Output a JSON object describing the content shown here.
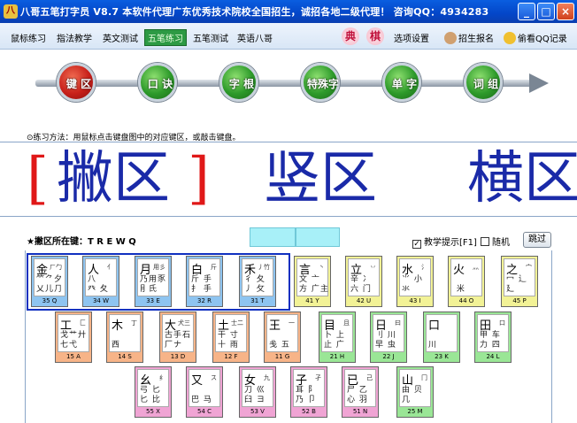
{
  "window": {
    "title": "八哥五笔打字员 V8.7   本软件代理广东优秀技术院校全国招生，诚招各地二级代理！ 咨询QQ：4934283",
    "buttons": [
      "_",
      "□",
      "×"
    ]
  },
  "menu": {
    "items": [
      "鼠标练习",
      "指法教学",
      "英文测试",
      "五笔练习",
      "五笔测试",
      "英语八哥"
    ],
    "active_index": 3,
    "seals": [
      "典",
      "棋"
    ],
    "right_items": [
      "选项设置",
      "招生报名",
      "偷看QQ记录"
    ]
  },
  "steps": {
    "labels": [
      "键 区",
      "口 诀",
      "字 根",
      "特殊字",
      "单 字",
      "词 组"
    ],
    "active_index": 0
  },
  "instructions": "⊙练习方法：用鼠标点击键盘图中的对应键区，或敲击键盘。",
  "display": {
    "bracket_left": "[",
    "current": "撇区",
    "bracket_right": "]",
    "next": "竖区",
    "after": "横区"
  },
  "hint": {
    "label": "★撇区所在键：",
    "keys": "T R E W Q"
  },
  "options": {
    "teach_hint": "教学提示[F1]",
    "teach_hint_checked": true,
    "random": "随机",
    "random_checked": false,
    "skip": "跳过"
  },
  "keyboard": {
    "rows": [
      [
        {
          "root": "金",
          "code": "ㄏ勹",
          "subs": "⺮⺈夕\n乂儿⺆",
          "label": "35 Q",
          "color": "blue"
        },
        {
          "root": "人",
          "code": "亻",
          "subs": "八\n癶 夂",
          "label": "34 W",
          "color": "blue"
        },
        {
          "root": "月",
          "code": "用彡",
          "subs": "乃用豕\n⺝氏",
          "label": "33 E",
          "color": "blue"
        },
        {
          "root": "白",
          "code": "斤",
          "subs": "斤 手\n⺘ 手",
          "label": "32 R",
          "color": "blue"
        },
        {
          "root": "禾",
          "code": "丿竹",
          "subs": "彳 夂\n丿 攵",
          "label": "31 T",
          "color": "blue"
        },
        {
          "root": "言",
          "code": "丶",
          "subs": "文 亠\n方 广主",
          "label": "41 Y",
          "color": "yellow"
        },
        {
          "root": "立",
          "code": "丷",
          "subs": "辛 冫\n六 门",
          "label": "42 U",
          "color": "yellow"
        },
        {
          "root": "水",
          "code": "氵",
          "subs": "⺌ 小\n氺",
          "label": "43 I",
          "color": "yellow"
        },
        {
          "root": "火",
          "code": "灬",
          "subs": "\n 米",
          "label": "44 O",
          "color": "yellow"
        },
        {
          "root": "之",
          "code": "宀",
          "subs": "冖 辶\n廴",
          "label": "45 P",
          "color": "yellow"
        }
      ],
      [
        {
          "root": "工",
          "code": "匚",
          "subs": "戈艹廾\n七弋",
          "label": "15 A",
          "color": "orange"
        },
        {
          "root": "木",
          "code": "丁",
          "subs": "\n西",
          "label": "14 S",
          "color": "orange"
        },
        {
          "root": "大",
          "code": "犬三",
          "subs": "古手石\n厂ナ",
          "label": "13 D",
          "color": "orange"
        },
        {
          "root": "土",
          "code": "士二",
          "subs": "干 寸\n十 雨",
          "label": "12 F",
          "color": "orange"
        },
        {
          "root": "王",
          "code": "一",
          "subs": "\n戋 五",
          "label": "11 G",
          "color": "orange"
        },
        {
          "root": "目",
          "code": "且",
          "subs": "卜 上\n止 广",
          "label": "21 H",
          "color": "green"
        },
        {
          "root": "日",
          "code": "曰",
          "subs": "刂 川\n早 虫",
          "label": "22 J",
          "color": "green"
        },
        {
          "root": "口",
          "code": "",
          "subs": "\n川",
          "label": "23 K",
          "color": "green"
        },
        {
          "root": "田",
          "code": "口",
          "subs": "甲 车\n力 四",
          "label": "24 L",
          "color": "green"
        }
      ],
      [
        {
          "root": "幺",
          "code": "纟",
          "subs": "弓 匕\n匕 比",
          "label": "55 X",
          "color": "pink"
        },
        {
          "root": "又",
          "code": "ス",
          "subs": "\n巴 马",
          "label": "54 C",
          "color": "pink"
        },
        {
          "root": "女",
          "code": "九",
          "subs": "刀 巛\n臼 ヨ",
          "label": "53 V",
          "color": "pink"
        },
        {
          "root": "子",
          "code": "孑",
          "subs": "耳 阝\n乃 卩",
          "label": "52 B",
          "color": "pink"
        },
        {
          "root": "已",
          "code": "己",
          "subs": "尸 乙\n心 羽",
          "label": "51 N",
          "color": "pink"
        },
        {
          "root": "山",
          "code": "冂",
          "subs": "由 贝\n几",
          "label": "25 M",
          "color": "green"
        }
      ]
    ]
  }
}
